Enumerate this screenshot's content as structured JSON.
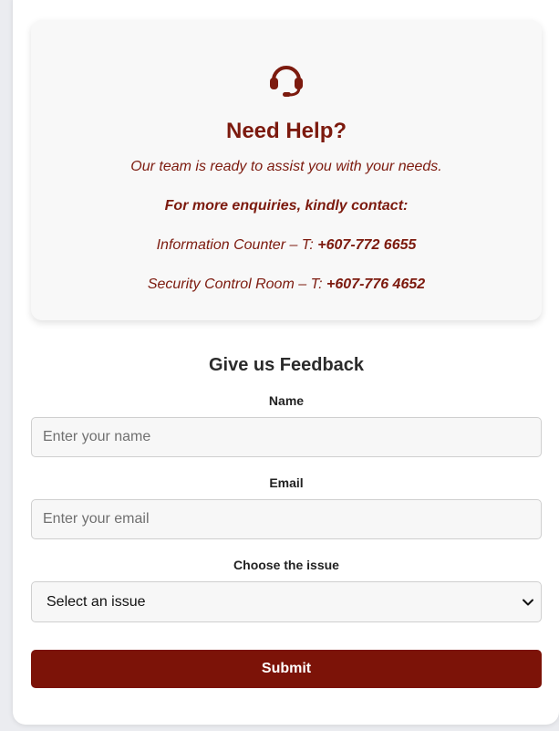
{
  "help": {
    "icon": "headset-icon",
    "title": "Need Help?",
    "subtitle": "Our team is ready to assist you with your needs.",
    "more": "For more enquiries, kindly contact:",
    "contacts": [
      {
        "label": "Information Counter – T: ",
        "number": "+607-772 6655"
      },
      {
        "label": "Security Control Room – T: ",
        "number": "+607-776 4652"
      }
    ]
  },
  "feedback": {
    "title": "Give us Feedback",
    "name_label": "Name",
    "name_placeholder": "Enter your name",
    "email_label": "Email",
    "email_placeholder": "Enter your email",
    "issue_label": "Choose the issue",
    "issue_selected": "Select an issue",
    "submit_label": "Submit"
  },
  "colors": {
    "accent": "#7c1a0e",
    "button": "#7c1308"
  }
}
